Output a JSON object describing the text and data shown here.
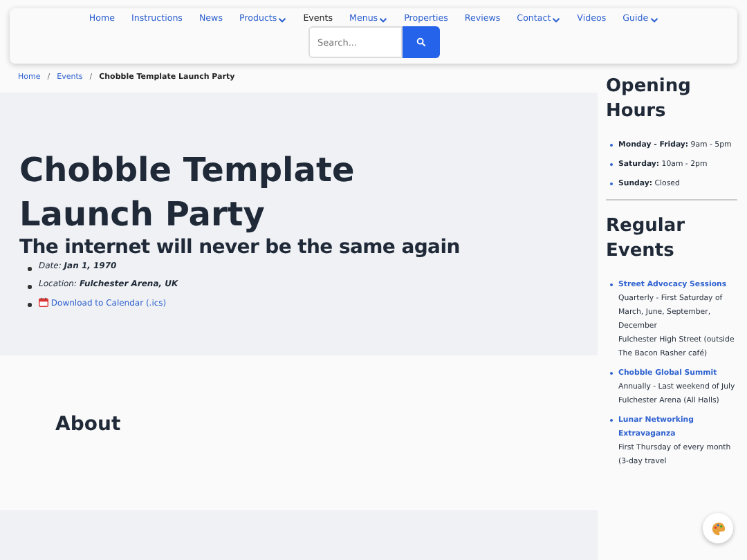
{
  "nav": {
    "items": [
      {
        "label": "Home",
        "selected": false,
        "dropdown": false
      },
      {
        "label": "Instructions",
        "selected": false,
        "dropdown": false
      },
      {
        "label": "News",
        "selected": false,
        "dropdown": false
      },
      {
        "label": "Products",
        "selected": false,
        "dropdown": true
      },
      {
        "label": "Events",
        "selected": true,
        "dropdown": false
      },
      {
        "label": "Menus",
        "selected": false,
        "dropdown": true
      },
      {
        "label": "Properties",
        "selected": false,
        "dropdown": false
      },
      {
        "label": "Reviews",
        "selected": false,
        "dropdown": false
      },
      {
        "label": "Contact",
        "selected": false,
        "dropdown": true
      },
      {
        "label": "Videos",
        "selected": false,
        "dropdown": false
      },
      {
        "label": "Guide",
        "selected": false,
        "dropdown": true
      }
    ],
    "search": {
      "placeholder": "Search..."
    }
  },
  "breadcrumb": [
    {
      "label": "Home",
      "kind": "link"
    },
    {
      "separator": "/",
      "label": "Events",
      "kind": "link"
    },
    {
      "separator": "/",
      "label": "Chobble Template Launch Party",
      "kind": "current"
    }
  ],
  "event": {
    "title": "Chobble Template Launch Party",
    "subtitle": "The internet will never be the same again",
    "details": [
      {
        "label": "Date:",
        "value": "Jan 1, 1970"
      },
      {
        "label": "Location:",
        "value": "Fulchester Arena, UK"
      }
    ],
    "calendar_link": "Download to Calendar (.ics)"
  },
  "about": {
    "heading": "About"
  },
  "sidebar": {
    "hours": {
      "heading": "Opening Hours",
      "items": [
        {
          "day": "Monday - Friday:",
          "time": "9am - 5pm"
        },
        {
          "day": "Saturday:",
          "time": "10am - 2pm"
        },
        {
          "day": "Sunday:",
          "time": "Closed"
        }
      ]
    },
    "events": {
      "heading": "Regular Events",
      "items": [
        {
          "name": "Street Advocacy Sessions",
          "lines": [
            "Quarterly - First Saturday of March, June, September, December",
            "Fulchester High Street (outside The Bacon Rasher café)"
          ]
        },
        {
          "name": "Chobble Global Summit",
          "lines": [
            "Annually - Last weekend of July",
            "Fulchester Arena (All Halls)"
          ]
        },
        {
          "name": "Lunar Networking Extravaganza",
          "lines": [
            "First Thursday of every month (3-day travel"
          ]
        }
      ]
    }
  }
}
